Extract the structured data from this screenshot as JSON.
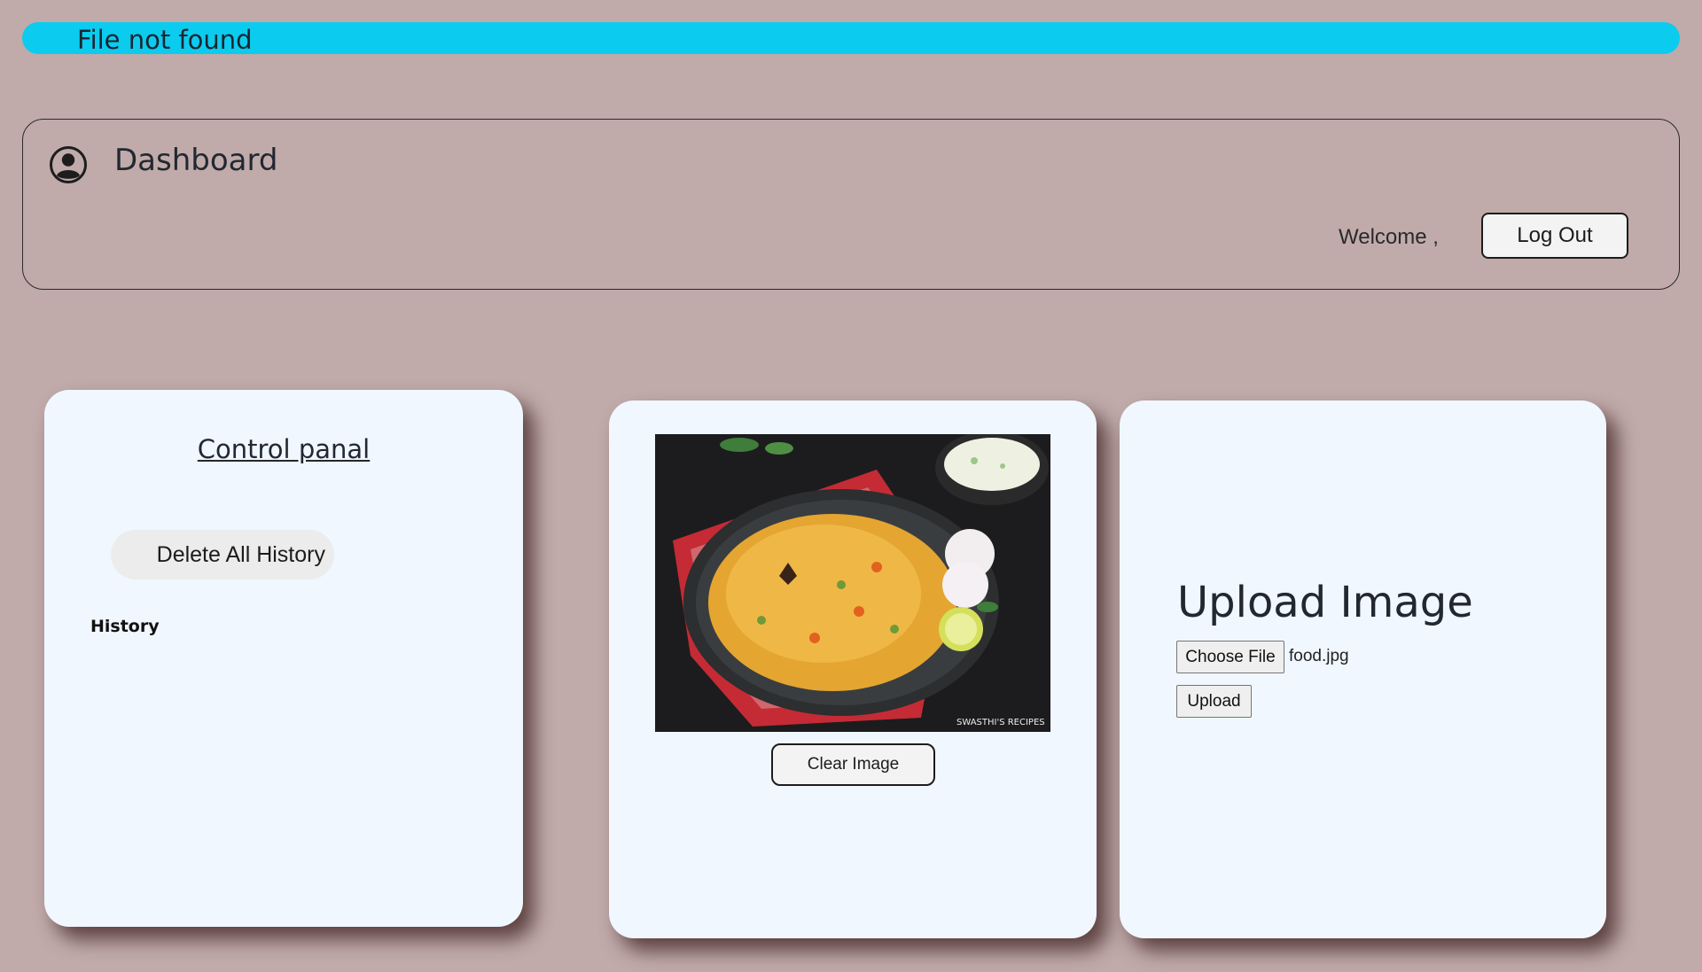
{
  "alert": {
    "message": "File not found",
    "color": "#0bcbef"
  },
  "header": {
    "title": "Dashboard",
    "user_icon": "user-circle-icon",
    "welcome_text": "Welcome ,",
    "logout_label": "Log Out"
  },
  "control_panel": {
    "title": "Control panal",
    "delete_label": "Delete All History",
    "history_label": "History"
  },
  "preview": {
    "image_alt": "biryani dish on a black plate with onion, lime and raita",
    "watermark": "SWASTHI'S RECIPES",
    "clear_label": "Clear Image"
  },
  "upload": {
    "title": "Upload Image",
    "choose_label": "Choose File",
    "file_name": "food.jpg",
    "upload_label": "Upload"
  },
  "colors": {
    "background": "#c0aaaa",
    "card": "#f0f7ff",
    "alert": "#0bcbef"
  }
}
